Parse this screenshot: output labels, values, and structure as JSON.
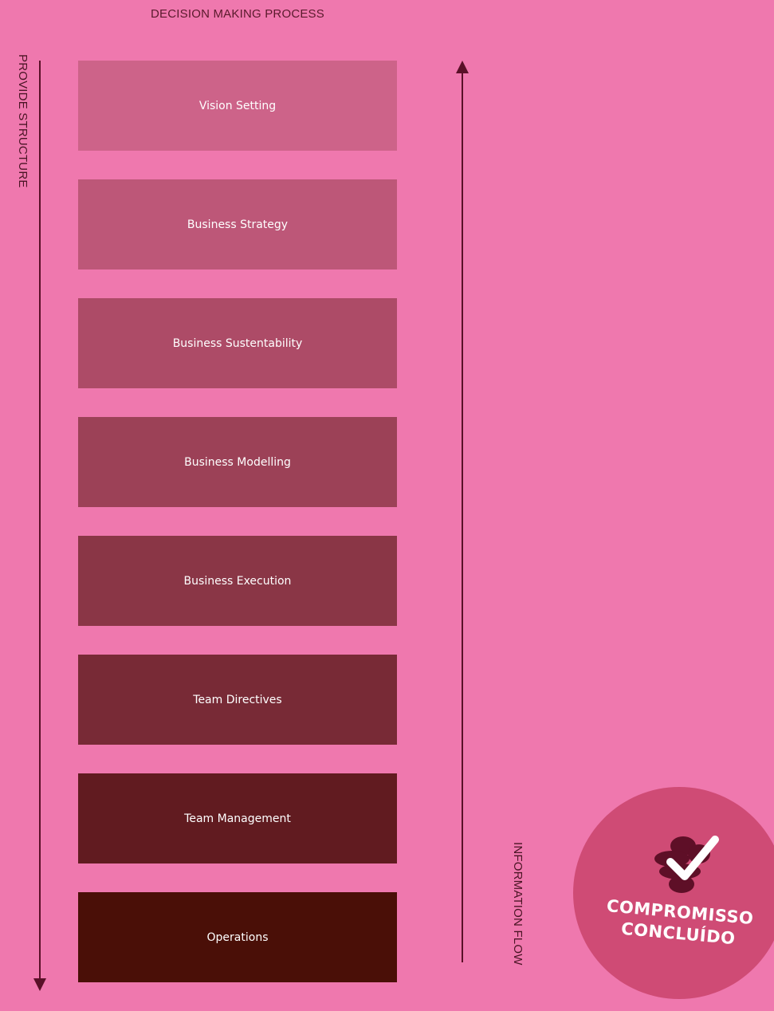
{
  "title": "DECISION MAKING PROCESS",
  "left_axis_label": "PROVIDE STRUCTURE",
  "right_axis_label": "INFORMATION FLOW",
  "boxes": [
    {
      "label": "Vision Setting",
      "color": "#cd6389"
    },
    {
      "label": "Business Strategy",
      "color": "#bd5778"
    },
    {
      "label": "Business Sustentability",
      "color": "#ad4b67"
    },
    {
      "label": "Business Modelling",
      "color": "#9c4157"
    },
    {
      "label": "Business Execution",
      "color": "#8a3646"
    },
    {
      "label": "Team Directives",
      "color": "#782a36"
    },
    {
      "label": "Team Management",
      "color": "#611b20"
    },
    {
      "label": "Operations",
      "color": "#4a0f07"
    }
  ],
  "badge": {
    "line1": "COMPROMISSO",
    "line2": "CONCLUÍDO",
    "icon": "check-icon",
    "color": "#cf4b75"
  },
  "colors": {
    "background": "#ef78ae",
    "arrow": "#5a1028"
  }
}
